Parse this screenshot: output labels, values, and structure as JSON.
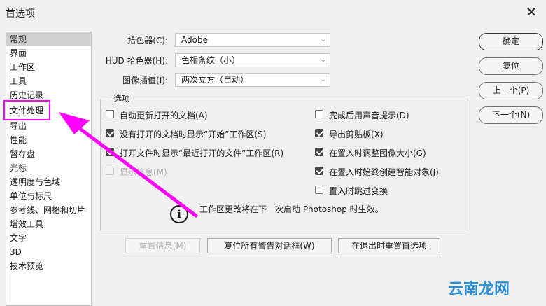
{
  "window": {
    "title": "首选项",
    "close_symbol": "✕"
  },
  "sidebar": {
    "items": [
      {
        "label": "常规"
      },
      {
        "label": "界面"
      },
      {
        "label": "工作区"
      },
      {
        "label": "工具"
      },
      {
        "label": "历史记录"
      },
      {
        "label": "文件处理"
      },
      {
        "label": "导出"
      },
      {
        "label": "性能"
      },
      {
        "label": "暂存盘"
      },
      {
        "label": "光标"
      },
      {
        "label": "透明度与色域"
      },
      {
        "label": "单位与标尺"
      },
      {
        "label": "参考线、网格和切片"
      },
      {
        "label": "增效工具"
      },
      {
        "label": "文字"
      },
      {
        "label": "3D"
      },
      {
        "label": "技术预览"
      }
    ],
    "selected": "常规"
  },
  "fields": {
    "color_picker": {
      "label": "拾色器(C):",
      "value": "Adobe"
    },
    "hud_picker": {
      "label": "HUD 拾色器(H):",
      "value": "色相条纹（小）"
    },
    "interpolation": {
      "label": "图像插值(I):",
      "value": "两次立方（自动）"
    }
  },
  "options": {
    "label": "选项",
    "left": [
      {
        "label": "自动更新打开的文档(A)",
        "checked": false,
        "disabled": false
      },
      {
        "label": "没有打开的文档时显示“开始”工作区(S)",
        "checked": true,
        "disabled": false
      },
      {
        "label": "打开文件时显示“最近打开的文件”工作区(R)",
        "checked": true,
        "disabled": false
      },
      {
        "label": "显示信息(M)",
        "checked": false,
        "disabled": true
      }
    ],
    "right": [
      {
        "label": "完成后用声音提示(D)",
        "checked": false,
        "disabled": false
      },
      {
        "label": "导出剪贴板(X)",
        "checked": true,
        "disabled": false
      },
      {
        "label": "在置入时调整图像大小(G)",
        "checked": true,
        "disabled": false
      },
      {
        "label": "在置入时始终创建智能对象(J)",
        "checked": true,
        "disabled": false
      },
      {
        "label": "置入时跳过变换",
        "checked": false,
        "disabled": false
      }
    ],
    "info_symbol": "i",
    "info_text": "工作区更改将在下一次启动 Photoshop 时生效。"
  },
  "bottom_buttons": {
    "reset_info": "重置信息(M)",
    "reset_warnings": "复位所有警告对话框(W)",
    "reset_on_quit": "在退出时重置首选项"
  },
  "right_buttons": {
    "ok": "确定",
    "reset": "复位",
    "prev": "上一个(P)",
    "next": "下一个(N)"
  },
  "annotation_color": "#ff00ff",
  "watermark": "云南龙网"
}
